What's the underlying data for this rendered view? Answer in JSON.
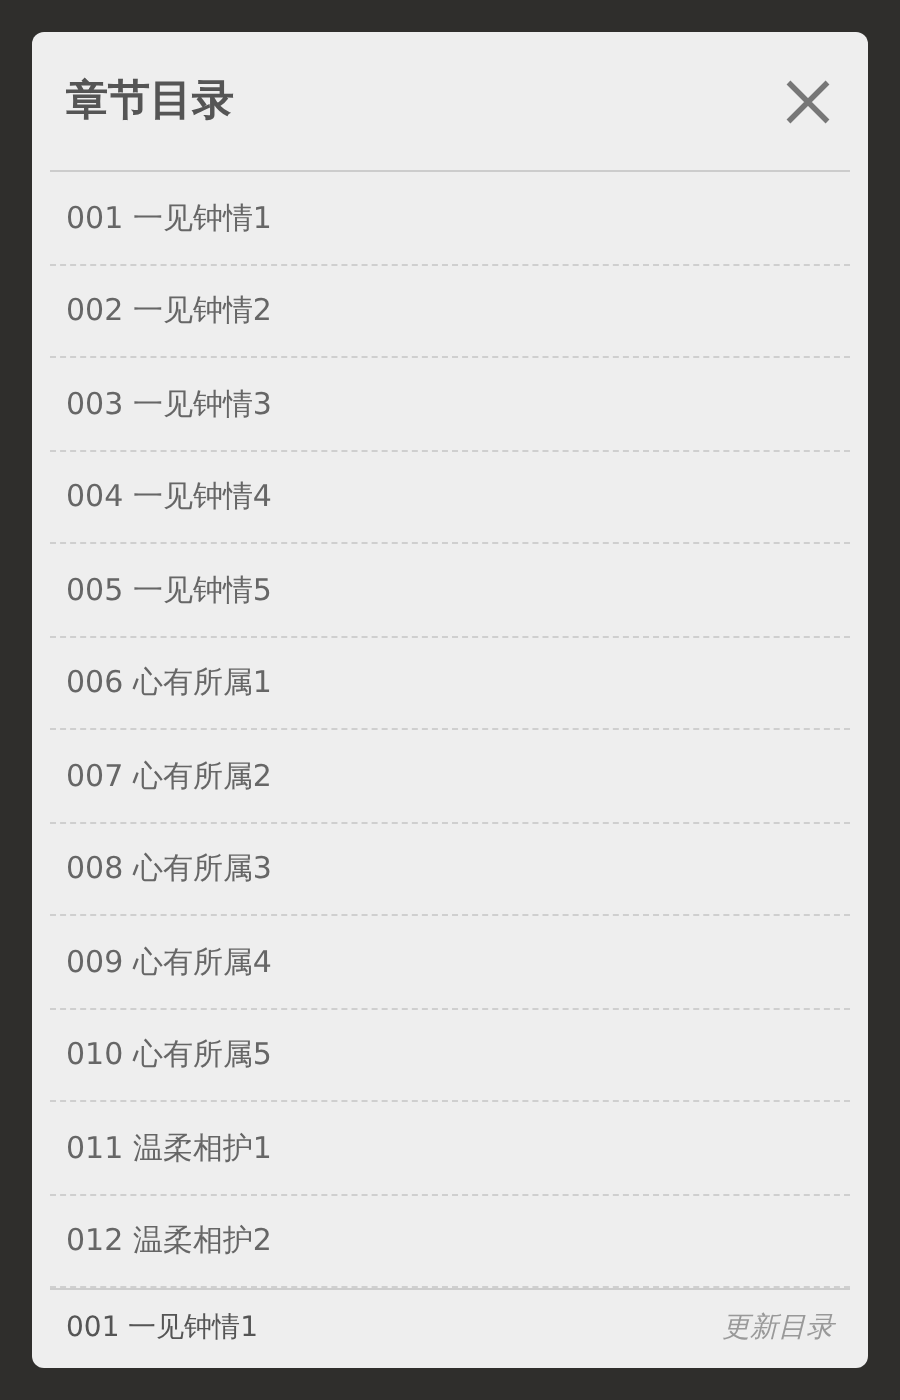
{
  "dialog": {
    "title": "章节目录",
    "chapters": [
      {
        "label": "001 一见钟情1"
      },
      {
        "label": "002 一见钟情2"
      },
      {
        "label": "003 一见钟情3"
      },
      {
        "label": "004 一见钟情4"
      },
      {
        "label": "005 一见钟情5"
      },
      {
        "label": "006 心有所属1"
      },
      {
        "label": "007 心有所属2"
      },
      {
        "label": "008 心有所属3"
      },
      {
        "label": "009 心有所属4"
      },
      {
        "label": "010 心有所属5"
      },
      {
        "label": "011 温柔相护1"
      },
      {
        "label": "012 温柔相护2"
      }
    ],
    "footer": {
      "current": "001 一见钟情1",
      "update_button": "更新目录"
    }
  }
}
